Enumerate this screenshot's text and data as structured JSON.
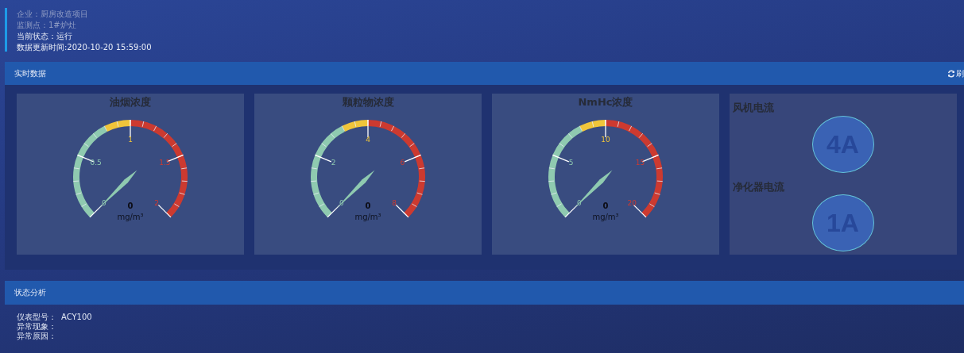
{
  "info": [
    {
      "text": "企业：厨房改造项目",
      "dim": true
    },
    {
      "text": "监测点：1#炉灶",
      "dim": true
    },
    {
      "text": "当前状态：运行",
      "dim": false
    },
    {
      "text": "数据更新时间:2020-10-20 15:59:00",
      "dim": false
    }
  ],
  "realtime": {
    "title": "实时数据",
    "refresh": "刷",
    "gauges": [
      {
        "title": "油烟浓度",
        "ticks": [
          "0",
          "0.5",
          "1",
          "1.5",
          "2"
        ],
        "value": "0",
        "unit": "mg/m³"
      },
      {
        "title": "颗粒物浓度",
        "ticks": [
          "0",
          "2",
          "4",
          "6",
          "8"
        ],
        "value": "0",
        "unit": "mg/m³"
      },
      {
        "title": "NmHc浓度",
        "ticks": [
          "0",
          "5",
          "10",
          "15",
          "20"
        ],
        "value": "0",
        "unit": "mg/m³"
      }
    ],
    "currents": [
      {
        "label": "风机电流",
        "value": "4A"
      },
      {
        "label": "净化器电流",
        "value": "1A"
      }
    ]
  },
  "analysis": {
    "title": "状态分析",
    "rows": [
      {
        "label": "仪表型号：",
        "value": "ACY100"
      },
      {
        "label": "异常现象："
      },
      {
        "label": "异常原因："
      }
    ]
  }
}
